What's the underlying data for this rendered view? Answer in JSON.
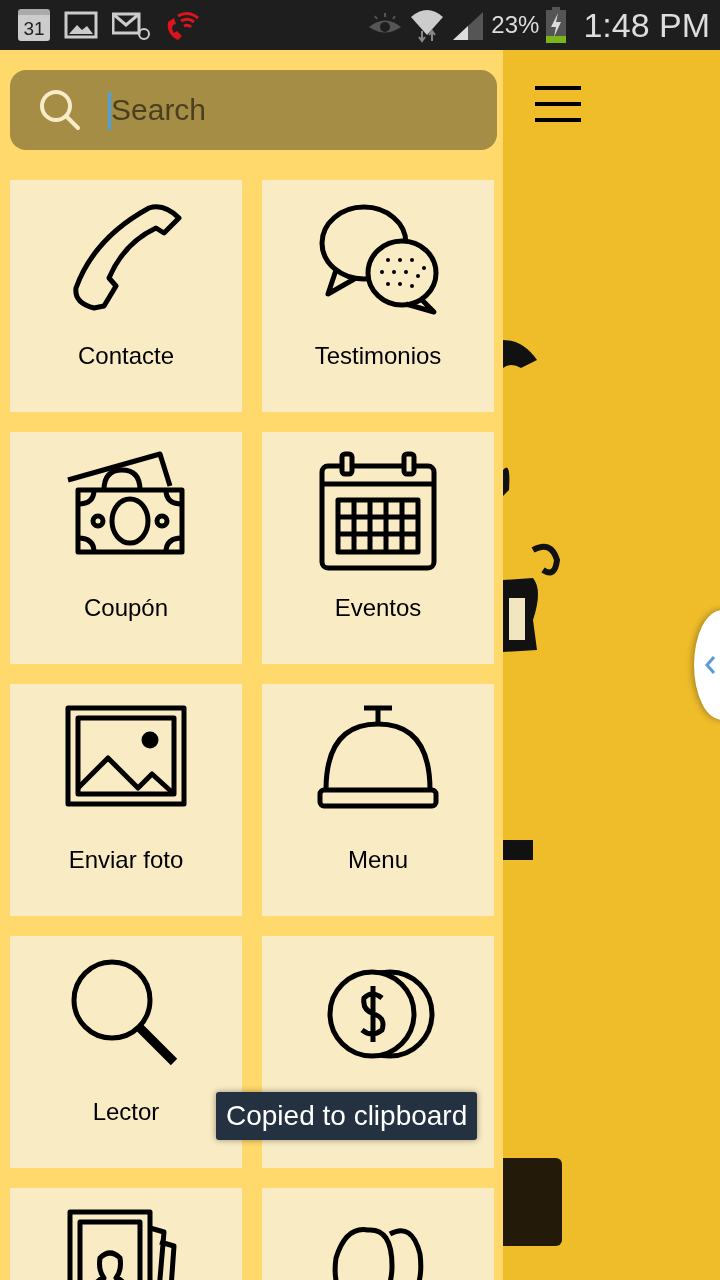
{
  "status_bar": {
    "calendar_day": "31",
    "battery": "23%",
    "time": "1:48 PM"
  },
  "search": {
    "placeholder": "Search"
  },
  "tiles": [
    {
      "kind": "labeled",
      "label": "Contacte"
    },
    {
      "kind": "labeled",
      "label": "Testimonios"
    },
    {
      "kind": "labeled",
      "label": "Coupón"
    },
    {
      "kind": "labeled",
      "label": "Eventos"
    },
    {
      "kind": "labeled",
      "label": "Enviar foto"
    },
    {
      "kind": "labeled",
      "label": "Menu"
    },
    {
      "kind": "labeled",
      "label": "Lector"
    },
    {
      "kind": "icon_only"
    },
    {
      "kind": "icon_only"
    },
    {
      "kind": "icon_only"
    }
  ],
  "toast": {
    "text": "Copied to clipboard"
  }
}
